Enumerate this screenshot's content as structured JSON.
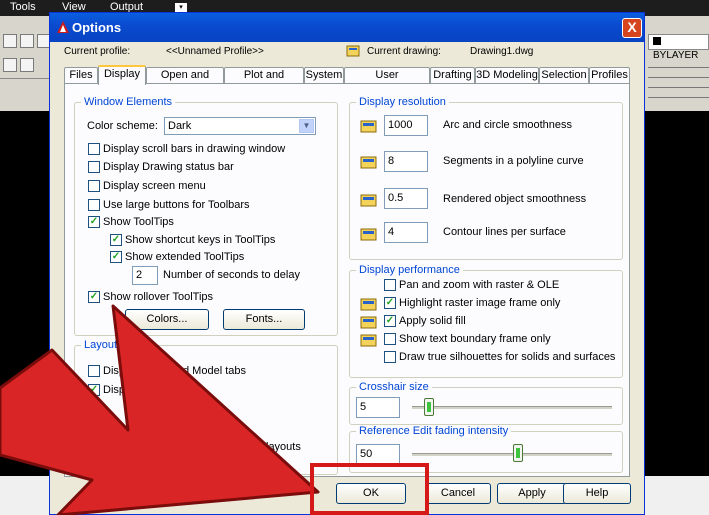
{
  "app": {
    "menu": [
      "Tools",
      "View",
      "Output"
    ],
    "layer_label": "BYLAYER"
  },
  "dialog": {
    "title": "Options",
    "close_label": "X",
    "current_profile_label": "Current profile:",
    "current_profile_value": "<<Unnamed Profile>>",
    "current_drawing_label": "Current drawing:",
    "current_drawing_value": "Drawing1.dwg",
    "tabs": [
      "Files",
      "Display",
      "Open and Save",
      "Plot and Publish",
      "System",
      "User Preferences",
      "Drafting",
      "3D Modeling",
      "Selection",
      "Profiles"
    ],
    "active_tab": "Display"
  },
  "window_elements": {
    "legend": "Window Elements",
    "color_scheme_label": "Color scheme:",
    "color_scheme_value": "Dark",
    "options": [
      {
        "label": "Display scroll bars in drawing window",
        "checked": false
      },
      {
        "label": "Display Drawing status bar",
        "checked": false
      },
      {
        "label": "Display screen menu",
        "checked": false
      },
      {
        "label": "Use large buttons for Toolbars",
        "checked": false
      },
      {
        "label": "Show ToolTips",
        "checked": true
      },
      {
        "label": "Show shortcut keys in ToolTips",
        "checked": true
      },
      {
        "label": "Show extended ToolTips",
        "checked": true
      },
      {
        "label": "Show rollover ToolTips",
        "checked": true
      }
    ],
    "delay_value": "2",
    "delay_label": "Number of seconds to delay",
    "colors_button": "Colors...",
    "fonts_button": "Fonts..."
  },
  "layout_elements": {
    "legend": "Layout",
    "visible_fragments": [
      "Disp",
      "d Model tabs",
      "Disp",
      "layouts"
    ]
  },
  "display_resolution": {
    "legend": "Display resolution",
    "items": [
      {
        "value": "1000",
        "label": "Arc and circle smoothness"
      },
      {
        "value": "8",
        "label": "Segments in a polyline curve"
      },
      {
        "value": "0.5",
        "label": "Rendered object smoothness"
      },
      {
        "value": "4",
        "label": "Contour lines per surface"
      }
    ]
  },
  "display_performance": {
    "legend": "Display performance",
    "options": [
      {
        "label": "Pan and zoom with raster & OLE",
        "checked": false
      },
      {
        "label": "Highlight raster image frame only",
        "checked": true
      },
      {
        "label": "Apply solid fill",
        "checked": true
      },
      {
        "label": "Show text boundary frame only",
        "checked": false
      },
      {
        "label": "Draw true silhouettes for solids and surfaces",
        "checked": false
      }
    ]
  },
  "crosshair": {
    "legend": "Crosshair size",
    "value": "5",
    "slider_level": 5
  },
  "ref_edit": {
    "legend": "Reference Edit fading intensity",
    "value": "50",
    "slider_level": 50
  },
  "buttons": {
    "ok": "OK",
    "cancel": "Cancel",
    "apply": "Apply",
    "help": "Help"
  },
  "colors": {
    "annotation": "#d51919",
    "title_bar": "#0a4bd0",
    "legend_text": "#0046d5"
  }
}
